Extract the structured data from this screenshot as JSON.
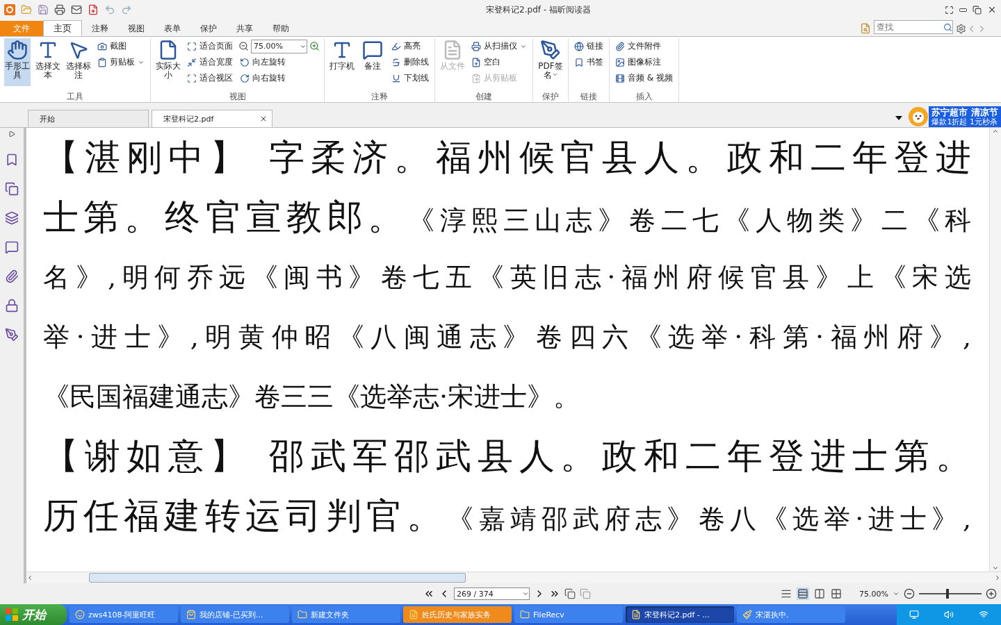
{
  "window": {
    "title": "宋登科记2.pdf - 福昕阅读器"
  },
  "menu_tabs": [
    {
      "label": "文件",
      "kind": "file",
      "selected": false
    },
    {
      "label": "主页",
      "kind": "tab",
      "selected": true
    },
    {
      "label": "注释",
      "kind": "tab",
      "selected": false
    },
    {
      "label": "视图",
      "kind": "tab",
      "selected": false
    },
    {
      "label": "表单",
      "kind": "tab",
      "selected": false
    },
    {
      "label": "保护",
      "kind": "tab",
      "selected": false
    },
    {
      "label": "共享",
      "kind": "tab",
      "selected": false
    },
    {
      "label": "帮助",
      "kind": "tab",
      "selected": false
    }
  ],
  "search": {
    "placeholder": "查找"
  },
  "ribbon": {
    "groups": [
      {
        "label": "工具",
        "items": [
          {
            "kind": "large",
            "label": "手形工具",
            "selected": true
          },
          {
            "kind": "large",
            "label": "选择文本",
            "selected": false
          },
          {
            "kind": "large",
            "label": "选择标注",
            "selected": false
          },
          {
            "kind": "small",
            "label": "截图"
          },
          {
            "kind": "small",
            "label": "剪贴板",
            "dropdown": true
          }
        ]
      },
      {
        "label": "视图",
        "items": [
          {
            "kind": "large",
            "label": "实际大小"
          },
          {
            "kind": "small",
            "label": "适合页面"
          },
          {
            "kind": "small",
            "label": "适合宽度"
          },
          {
            "kind": "small",
            "label": "适合视区"
          },
          {
            "kind": "zoom",
            "value": "75.00%"
          },
          {
            "kind": "small",
            "label": "向左旋转"
          },
          {
            "kind": "small",
            "label": "向右旋转"
          }
        ]
      },
      {
        "label": "注释",
        "items": [
          {
            "kind": "large",
            "label": "打字机"
          },
          {
            "kind": "large",
            "label": "备注"
          },
          {
            "kind": "small",
            "label": "高亮"
          },
          {
            "kind": "small",
            "label": "删除线"
          },
          {
            "kind": "small",
            "label": "下划线"
          }
        ]
      },
      {
        "label": "创建",
        "items": [
          {
            "kind": "large",
            "label": "从文件",
            "disabled": true
          },
          {
            "kind": "small",
            "label": "从扫描仪",
            "dropdown": true
          },
          {
            "kind": "small",
            "label": "空白"
          },
          {
            "kind": "small",
            "label": "从剪贴板",
            "disabled": true
          }
        ]
      },
      {
        "label": "保护",
        "items": [
          {
            "kind": "large",
            "label": "PDF签名",
            "dropdown": true
          }
        ]
      },
      {
        "label": "链接",
        "items": [
          {
            "kind": "small",
            "label": "链接"
          },
          {
            "kind": "small",
            "label": "书签"
          }
        ]
      },
      {
        "label": "插入",
        "items": [
          {
            "kind": "small",
            "label": "文件附件"
          },
          {
            "kind": "small",
            "label": "图像标注"
          },
          {
            "kind": "small",
            "label": "音频 & 视频"
          }
        ]
      }
    ]
  },
  "doc_tabs": [
    {
      "label": "开始",
      "selected": false,
      "closable": false
    },
    {
      "label": "宋登科记2.pdf",
      "selected": true,
      "closable": true
    }
  ],
  "ad": {
    "title": "苏宁超市 清凉节",
    "subtitle": "爆款1折起 1元秒杀"
  },
  "document": {
    "lines": [
      {
        "justified": true,
        "segments": [
          {
            "kind": "main",
            "text": "【湛刚中】 字柔济。福州候官县人。政和二年登进"
          }
        ]
      },
      {
        "justified": true,
        "segments": [
          {
            "kind": "main",
            "text": "士第。终官宣教郎。"
          },
          {
            "kind": "citation",
            "text": "《淳熙三山志》卷二七《人物类》二《科"
          }
        ]
      },
      {
        "justified": true,
        "segments": [
          {
            "kind": "citation",
            "text": "名》,明何乔远《闽书》卷七五《英旧志·福州府候官县》上《宋选"
          }
        ]
      },
      {
        "justified": true,
        "segments": [
          {
            "kind": "citation",
            "text": "举·进士》,明黄仲昭《八闽通志》卷四六《选举·科第·福州府》,"
          }
        ]
      },
      {
        "justified": false,
        "segments": [
          {
            "kind": "citation",
            "text": "《民国福建通志》卷三三《选举志·宋进士》。"
          }
        ]
      },
      {
        "justified": true,
        "segments": [
          {
            "kind": "main",
            "text": "【谢如意】 邵武军邵武县人。政和二年登进士第。"
          }
        ]
      },
      {
        "justified": true,
        "segments": [
          {
            "kind": "main",
            "text": "历任福建转运司判官。"
          },
          {
            "kind": "citation",
            "text": "《嘉靖邵武府志》卷八《选举·进士》,"
          }
        ]
      }
    ]
  },
  "status_bar": {
    "page": "269 / 374",
    "zoom": "75.00%",
    "zoom_slider": {
      "level": 0.45
    },
    "views": [
      {
        "selected": false
      },
      {
        "selected": true
      },
      {
        "selected": false
      },
      {
        "selected": false
      }
    ]
  },
  "taskbar": {
    "start": "开始",
    "items": [
      {
        "label": "zws4108-阿里旺旺",
        "selected": false,
        "flashing": false
      },
      {
        "label": "我的店铺-已买到...",
        "selected": false,
        "flashing": false
      },
      {
        "label": "新建文件夹",
        "selected": false,
        "flashing": false
      },
      {
        "label": "姓氏历史与家族实务",
        "selected": false,
        "flashing": true
      },
      {
        "label": "FileRecv",
        "selected": false,
        "flashing": false
      },
      {
        "label": "宋登科记2.pdf - ...",
        "selected": true,
        "flashing": false
      },
      {
        "label": "宋湛执中.",
        "selected": false,
        "flashing": false
      }
    ]
  }
}
